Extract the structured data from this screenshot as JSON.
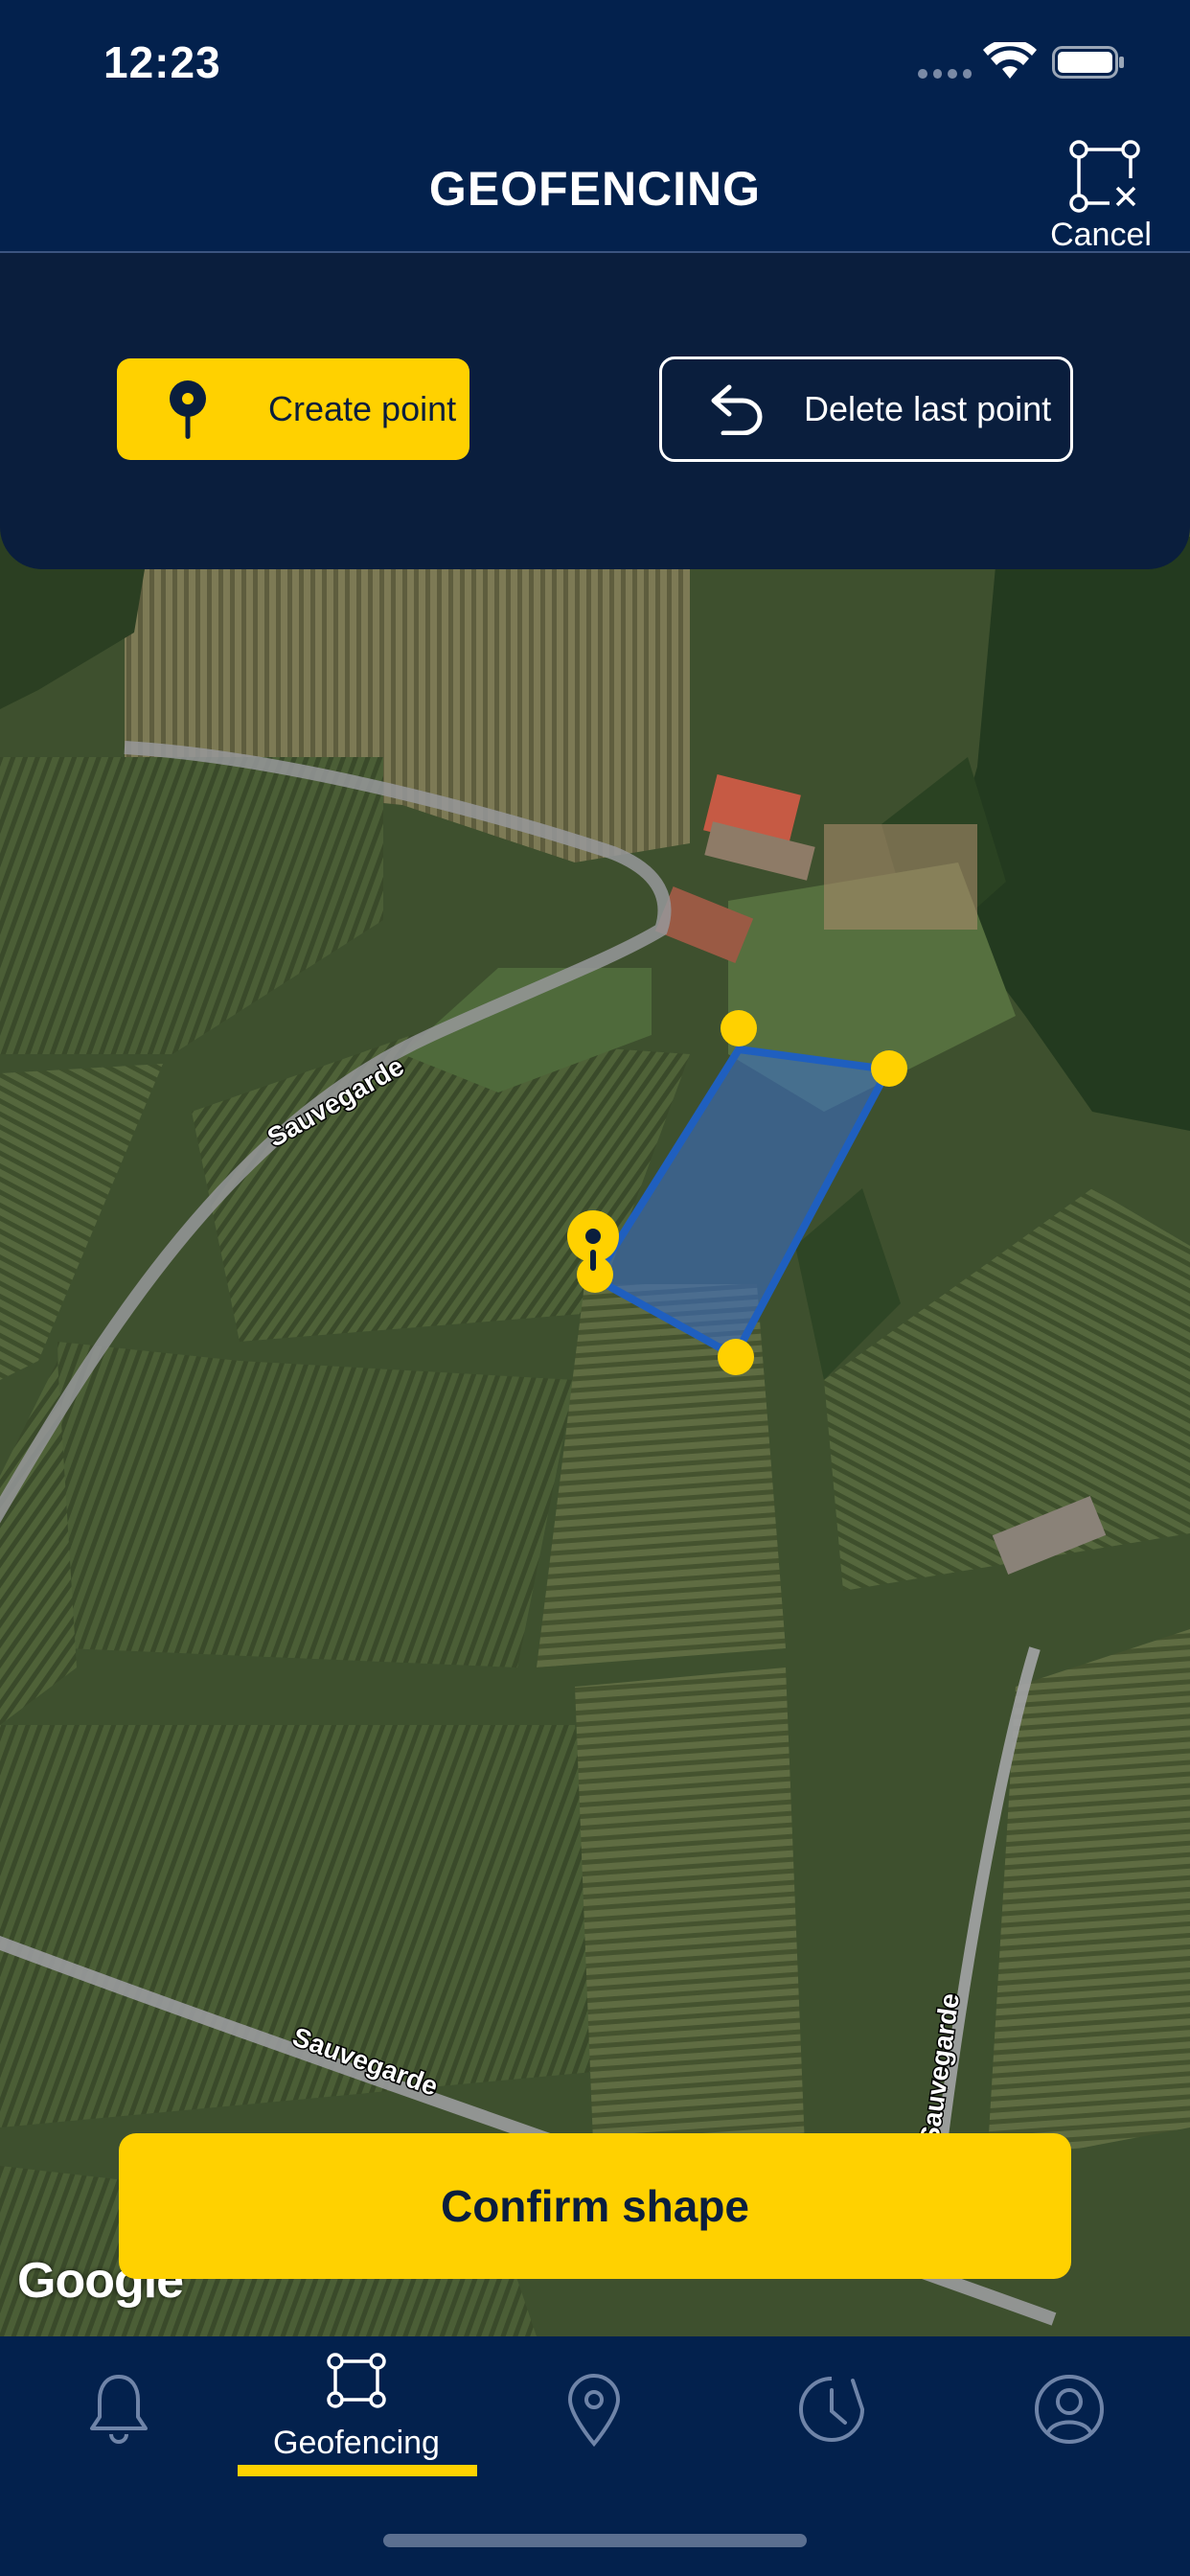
{
  "status_bar": {
    "time": "12:23"
  },
  "header": {
    "title": "GEOFENCING",
    "cancel_label": "Cancel"
  },
  "toolbar": {
    "create_point_label": "Create point",
    "delete_last_point_label": "Delete last point"
  },
  "map": {
    "road_labels": [
      "Sauvegarde",
      "Sauvegarde",
      "Sauvegarde"
    ],
    "provider": "Google"
  },
  "confirm": {
    "label": "Confirm shape"
  },
  "tabs": [
    {
      "icon": "bell-icon",
      "label": ""
    },
    {
      "icon": "geofence-icon",
      "label": "Geofencing",
      "active": true
    },
    {
      "icon": "location-pin-icon",
      "label": ""
    },
    {
      "icon": "history-icon",
      "label": ""
    },
    {
      "icon": "profile-icon",
      "label": ""
    }
  ],
  "colors": {
    "navy": "#03214d",
    "panel": "#0a1e3d",
    "accent_yellow": "#ffd100",
    "geofence_blue": "#1f5fbf"
  }
}
